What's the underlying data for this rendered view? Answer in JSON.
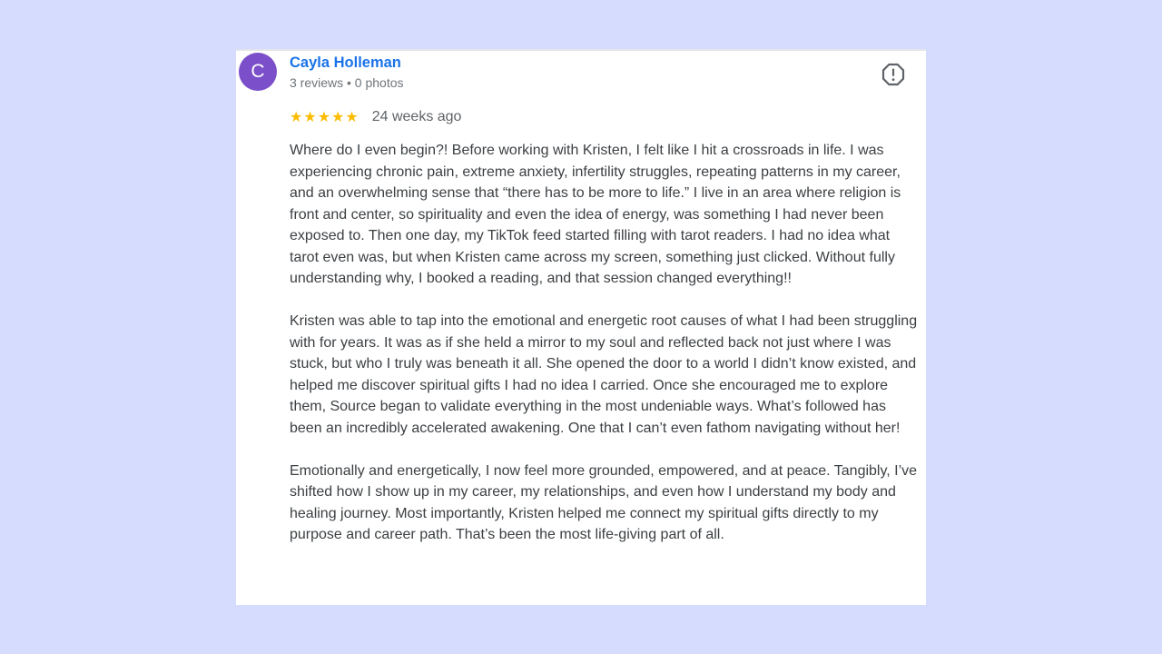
{
  "review": {
    "avatar_initial": "C",
    "reviewer_name": "Cayla Holleman",
    "reviewer_meta": "3 reviews • 0 photos",
    "stars": "★★★★★",
    "rating": 5,
    "date": "24 weeks ago",
    "flag_icon": "report-flag-icon",
    "star_color": "#fbbc04",
    "name_color": "#1a73e8",
    "avatar_color": "#7b4fc9",
    "paragraphs": [
      "Where do I even begin?! Before working with Kristen, I felt like I hit a crossroads in life. I was experiencing chronic pain, extreme anxiety, infertility struggles, repeating patterns in my career, and an overwhelming sense that “there has to be more to life.” I live in an area where religion is front and center, so spirituality and even the idea of energy, was something I had never been exposed to. Then one day, my TikTok feed started filling with tarot readers. I had no idea what tarot even was, but when Kristen came across my screen, something just clicked. Without fully understanding why, I booked a reading, and that session changed everything!!",
      "Kristen was able to tap into the emotional and energetic root causes of what I had been struggling with for years. It was as if she held a mirror to my soul and reflected back not just where I was stuck, but who I truly was beneath it all. She opened the door to a world I didn’t know existed, and helped me discover spiritual gifts I had no idea I carried. Once she encouraged me to explore them, Source began to validate everything in the most undeniable ways. What’s followed has been an incredibly accelerated awakening. One that I can’t even fathom navigating without her!",
      "Emotionally and energetically, I now feel more grounded, empowered, and at peace. Tangibly, I’ve shifted how I show up in my career, my relationships, and even how I understand my body and healing journey. Most importantly, Kristen helped me connect my spiritual gifts directly to my purpose and career path. That’s been the most life-giving part of all."
    ]
  }
}
